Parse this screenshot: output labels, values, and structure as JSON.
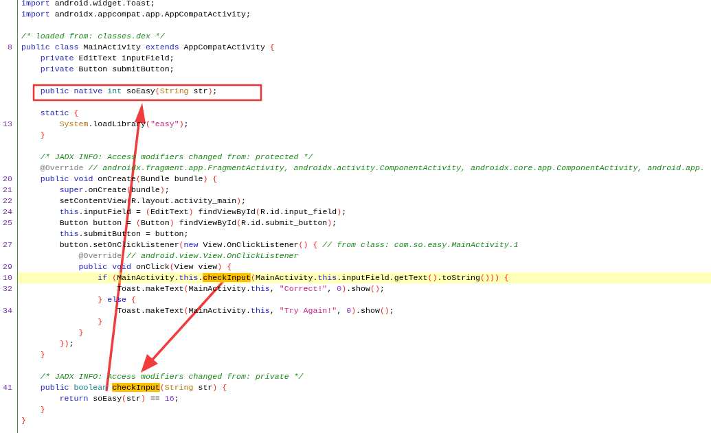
{
  "editor": {
    "lines": [
      {
        "highlighted": false,
        "tokens": [
          {
            "kind": "k",
            "text": "import"
          },
          {
            "kind": "p",
            "text": " android.widget.Toast;"
          }
        ]
      },
      {
        "highlighted": false,
        "tokens": [
          {
            "kind": "k",
            "text": "import"
          },
          {
            "kind": "p",
            "text": " androidx.appcompat.app.AppCompatActivity;"
          }
        ]
      },
      {
        "highlighted": false
      },
      {
        "highlighted": false,
        "tokens": [
          {
            "kind": "m",
            "text": "/* loaded from: classes.dex */"
          }
        ]
      },
      {
        "number": "8",
        "highlighted": false,
        "tokens": [
          {
            "kind": "k",
            "text": "public"
          },
          {
            "kind": "k",
            "text": " class"
          },
          {
            "kind": "p",
            "text": " MainActivity"
          },
          {
            "kind": "k",
            "text": " extends"
          },
          {
            "kind": "p",
            "text": " AppCompatActivity"
          },
          {
            "kind": "b",
            "text": " {"
          }
        ]
      },
      {
        "highlighted": false,
        "tokens": [
          {
            "kind": "k",
            "text": "    private"
          },
          {
            "kind": "p",
            "text": " EditText inputField;"
          }
        ]
      },
      {
        "highlighted": false,
        "tokens": [
          {
            "kind": "k",
            "text": "    private"
          },
          {
            "kind": "p",
            "text": " Button submitButton;"
          }
        ]
      },
      {
        "highlighted": false
      },
      {
        "highlighted": false,
        "tokens": [
          {
            "kind": "k",
            "text": "    public"
          },
          {
            "kind": "k",
            "text": " native"
          },
          {
            "kind": "t",
            "text": " int"
          },
          {
            "kind": "p",
            "text": " soEasy"
          },
          {
            "kind": "b",
            "text": "("
          },
          {
            "kind": "c",
            "text": "String"
          },
          {
            "kind": "p",
            "text": " str"
          },
          {
            "kind": "b",
            "text": ")"
          },
          {
            "kind": "p",
            "text": ";"
          }
        ]
      },
      {
        "highlighted": false
      },
      {
        "highlighted": false,
        "tokens": [
          {
            "kind": "k",
            "text": "    static"
          },
          {
            "kind": "b",
            "text": " {"
          }
        ]
      },
      {
        "number": "13",
        "highlighted": false,
        "tokens": [
          {
            "kind": "c",
            "text": "        System"
          },
          {
            "kind": "p",
            "text": ".loadLibrary"
          },
          {
            "kind": "b",
            "text": "("
          },
          {
            "kind": "s",
            "text": "\"easy\""
          },
          {
            "kind": "b",
            "text": ")"
          },
          {
            "kind": "p",
            "text": ";"
          }
        ]
      },
      {
        "highlighted": false,
        "tokens": [
          {
            "kind": "b",
            "text": "    }"
          }
        ]
      },
      {
        "highlighted": false
      },
      {
        "highlighted": false,
        "tokens": [
          {
            "kind": "m",
            "text": "    /* JADX INFO: Access modifiers changed from: protected */"
          }
        ]
      },
      {
        "highlighted": false,
        "tokens": [
          {
            "kind": "a",
            "text": "    @Override"
          },
          {
            "kind": "m",
            "text": " // androidx.fragment.app.FragmentActivity, androidx.activity.ComponentActivity, androidx.core.app.ComponentActivity, android.app."
          }
        ]
      },
      {
        "number": "20",
        "highlighted": false,
        "tokens": [
          {
            "kind": "k",
            "text": "    public"
          },
          {
            "kind": "k",
            "text": " void"
          },
          {
            "kind": "p",
            "text": " onCreate"
          },
          {
            "kind": "b",
            "text": "("
          },
          {
            "kind": "p",
            "text": "Bundle bundle"
          },
          {
            "kind": "b",
            "text": ")"
          },
          {
            "kind": "b",
            "text": " {"
          }
        ]
      },
      {
        "number": "21",
        "highlighted": false,
        "tokens": [
          {
            "kind": "k",
            "text": "        super"
          },
          {
            "kind": "p",
            "text": ".onCreate"
          },
          {
            "kind": "b",
            "text": "("
          },
          {
            "kind": "p",
            "text": "bundle"
          },
          {
            "kind": "b",
            "text": ")"
          },
          {
            "kind": "p",
            "text": ";"
          }
        ]
      },
      {
        "number": "22",
        "highlighted": false,
        "tokens": [
          {
            "kind": "p",
            "text": "        setContentView"
          },
          {
            "kind": "b",
            "text": "("
          },
          {
            "kind": "p",
            "text": "R.layout.activity_main"
          },
          {
            "kind": "b",
            "text": ")"
          },
          {
            "kind": "p",
            "text": ";"
          }
        ]
      },
      {
        "number": "24",
        "highlighted": false,
        "tokens": [
          {
            "kind": "k",
            "text": "        this"
          },
          {
            "kind": "p",
            "text": ".inputField ="
          },
          {
            "kind": "b",
            "text": " ("
          },
          {
            "kind": "p",
            "text": "EditText"
          },
          {
            "kind": "b",
            "text": ")"
          },
          {
            "kind": "p",
            "text": " findViewById"
          },
          {
            "kind": "b",
            "text": "("
          },
          {
            "kind": "p",
            "text": "R.id.input_field"
          },
          {
            "kind": "b",
            "text": ")"
          },
          {
            "kind": "p",
            "text": ";"
          }
        ]
      },
      {
        "number": "25",
        "highlighted": false,
        "tokens": [
          {
            "kind": "p",
            "text": "        Button button ="
          },
          {
            "kind": "b",
            "text": " ("
          },
          {
            "kind": "p",
            "text": "Button"
          },
          {
            "kind": "b",
            "text": ")"
          },
          {
            "kind": "p",
            "text": " findViewById"
          },
          {
            "kind": "b",
            "text": "("
          },
          {
            "kind": "p",
            "text": "R.id.submit_button"
          },
          {
            "kind": "b",
            "text": ")"
          },
          {
            "kind": "p",
            "text": ";"
          }
        ]
      },
      {
        "highlighted": false,
        "tokens": [
          {
            "kind": "k",
            "text": "        this"
          },
          {
            "kind": "p",
            "text": ".submitButton = button;"
          }
        ]
      },
      {
        "number": "27",
        "highlighted": false,
        "tokens": [
          {
            "kind": "p",
            "text": "        button.setOnClickListener"
          },
          {
            "kind": "b",
            "text": "("
          },
          {
            "kind": "k",
            "text": "new"
          },
          {
            "kind": "p",
            "text": " View.OnClickListener"
          },
          {
            "kind": "b",
            "text": "()"
          },
          {
            "kind": "b",
            "text": " {"
          },
          {
            "kind": "m",
            "text": " // from class: com.so.easy.MainActivity.1"
          }
        ]
      },
      {
        "highlighted": false,
        "tokens": [
          {
            "kind": "a",
            "text": "            @Override"
          },
          {
            "kind": "m",
            "text": " // android.view.View.OnClickListener"
          }
        ]
      },
      {
        "number": "29",
        "highlighted": false,
        "tokens": [
          {
            "kind": "k",
            "text": "            public"
          },
          {
            "kind": "k",
            "text": " void"
          },
          {
            "kind": "p",
            "text": " onClick"
          },
          {
            "kind": "b",
            "text": "("
          },
          {
            "kind": "p",
            "text": "View view"
          },
          {
            "kind": "b",
            "text": ")"
          },
          {
            "kind": "b",
            "text": " {"
          }
        ]
      },
      {
        "number": "10",
        "highlighted": true,
        "tokens": [
          {
            "kind": "k",
            "text": "                if"
          },
          {
            "kind": "b",
            "text": " ("
          },
          {
            "kind": "p",
            "text": "MainActivity."
          },
          {
            "kind": "k",
            "text": "this"
          },
          {
            "kind": "p",
            "text": "."
          },
          {
            "kind": "h",
            "text": "checkInput"
          },
          {
            "kind": "b",
            "text": "("
          },
          {
            "kind": "p",
            "text": "MainActivity."
          },
          {
            "kind": "k",
            "text": "this"
          },
          {
            "kind": "p",
            "text": ".inputField.getText"
          },
          {
            "kind": "b",
            "text": "()"
          },
          {
            "kind": "p",
            "text": ".toString"
          },
          {
            "kind": "b",
            "text": "()))"
          },
          {
            "kind": "b",
            "text": " {"
          }
        ]
      },
      {
        "number": "32",
        "highlighted": false,
        "tokens": [
          {
            "kind": "p",
            "text": "                    Toast.makeText"
          },
          {
            "kind": "b",
            "text": "("
          },
          {
            "kind": "p",
            "text": "MainActivity."
          },
          {
            "kind": "k",
            "text": "this"
          },
          {
            "kind": "p",
            "text": ","
          },
          {
            "kind": "s",
            "text": " \"Correct!\""
          },
          {
            "kind": "p",
            "text": ","
          },
          {
            "kind": "n",
            "text": " 0"
          },
          {
            "kind": "b",
            "text": ")"
          },
          {
            "kind": "p",
            "text": ".show"
          },
          {
            "kind": "b",
            "text": "()"
          },
          {
            "kind": "p",
            "text": ";"
          }
        ]
      },
      {
        "highlighted": false,
        "tokens": [
          {
            "kind": "b",
            "text": "                }"
          },
          {
            "kind": "k",
            "text": " else"
          },
          {
            "kind": "b",
            "text": " {"
          }
        ]
      },
      {
        "number": "34",
        "highlighted": false,
        "tokens": [
          {
            "kind": "p",
            "text": "                    Toast.makeText"
          },
          {
            "kind": "b",
            "text": "("
          },
          {
            "kind": "p",
            "text": "MainActivity."
          },
          {
            "kind": "k",
            "text": "this"
          },
          {
            "kind": "p",
            "text": ","
          },
          {
            "kind": "s",
            "text": " \"Try Again!\""
          },
          {
            "kind": "p",
            "text": ","
          },
          {
            "kind": "n",
            "text": " 0"
          },
          {
            "kind": "b",
            "text": ")"
          },
          {
            "kind": "p",
            "text": ".show"
          },
          {
            "kind": "b",
            "text": "()"
          },
          {
            "kind": "p",
            "text": ";"
          }
        ]
      },
      {
        "highlighted": false,
        "tokens": [
          {
            "kind": "b",
            "text": "                }"
          }
        ]
      },
      {
        "highlighted": false,
        "tokens": [
          {
            "kind": "b",
            "text": "            }"
          }
        ]
      },
      {
        "highlighted": false,
        "tokens": [
          {
            "kind": "b",
            "text": "        })"
          },
          {
            "kind": "p",
            "text": ";"
          }
        ]
      },
      {
        "highlighted": false,
        "tokens": [
          {
            "kind": "b",
            "text": "    }"
          }
        ]
      },
      {
        "highlighted": false
      },
      {
        "highlighted": false,
        "tokens": [
          {
            "kind": "m",
            "text": "    /* JADX INFO: Access modifiers changed from: private */"
          }
        ]
      },
      {
        "number": "41",
        "highlighted": false,
        "tokens": [
          {
            "kind": "k",
            "text": "    public"
          },
          {
            "kind": "t",
            "text": " boolean "
          },
          {
            "kind": "h",
            "text": "checkInput"
          },
          {
            "kind": "b",
            "text": "("
          },
          {
            "kind": "c",
            "text": "String"
          },
          {
            "kind": "p",
            "text": " str"
          },
          {
            "kind": "b",
            "text": ")"
          },
          {
            "kind": "b",
            "text": " {"
          }
        ]
      },
      {
        "highlighted": false,
        "tokens": [
          {
            "kind": "k",
            "text": "        return"
          },
          {
            "kind": "p",
            "text": " soEasy"
          },
          {
            "kind": "b",
            "text": "("
          },
          {
            "kind": "p",
            "text": "str"
          },
          {
            "kind": "b",
            "text": ")"
          },
          {
            "kind": "p",
            "text": " =="
          },
          {
            "kind": "n",
            "text": " 16"
          },
          {
            "kind": "p",
            "text": ";"
          }
        ]
      },
      {
        "highlighted": false,
        "tokens": [
          {
            "kind": "b",
            "text": "    }"
          }
        ]
      },
      {
        "highlighted": false,
        "tokens": [
          {
            "kind": "b",
            "text": "}"
          }
        ]
      }
    ]
  }
}
